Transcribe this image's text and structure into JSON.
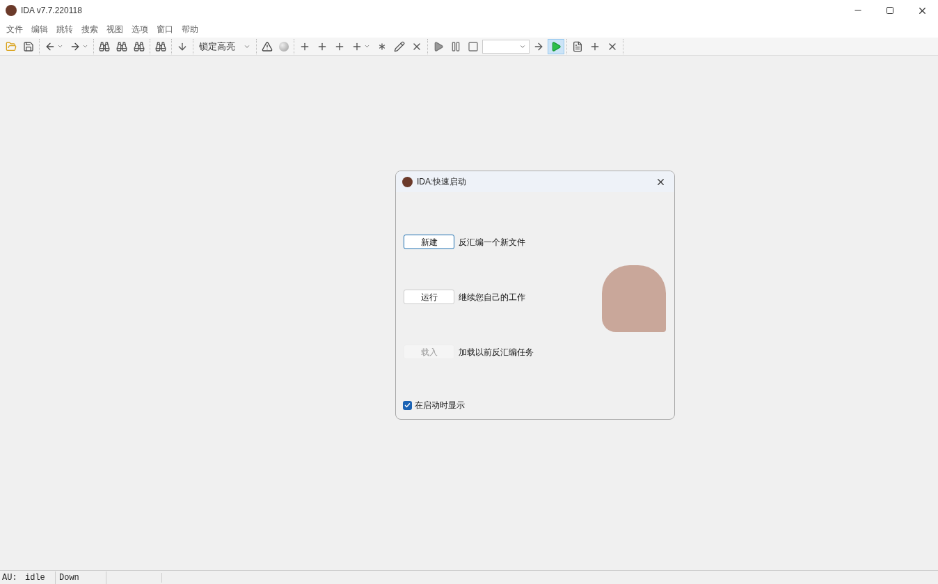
{
  "window": {
    "title": "IDA v7.7.220118"
  },
  "menu": [
    "文件",
    "编辑",
    "跳转",
    "搜索",
    "视图",
    "选项",
    "窗口",
    "帮助"
  ],
  "toolbar": [
    [
      {
        "kind": "open",
        "pressed": false
      },
      {
        "kind": "save",
        "pressed": false
      }
    ],
    [
      {
        "kind": "back",
        "pressed": false
      },
      {
        "kind": "forward",
        "pressed": false
      }
    ],
    [
      {
        "kind": "find-hex",
        "pressed": false
      },
      {
        "kind": "find-text",
        "pressed": false
      },
      {
        "kind": "find-binary",
        "pressed": false
      }
    ],
    [
      {
        "kind": "find-next",
        "pressed": false
      }
    ],
    [
      {
        "kind": "down",
        "pressed": false
      }
    ],
    [
      {
        "kind": "highlight-select",
        "label": "锁定高亮",
        "pressed": false
      }
    ],
    [
      {
        "kind": "warning",
        "pressed": false
      },
      {
        "kind": "sphere",
        "pressed": false
      }
    ],
    [
      {
        "kind": "code-plus",
        "pressed": false
      },
      {
        "kind": "data-plus",
        "pressed": false
      },
      {
        "kind": "string-plus",
        "pressed": false
      },
      {
        "kind": "struct-plus",
        "pressed": false
      },
      {
        "kind": "asterisk-plus",
        "pressed": false
      },
      {
        "kind": "edit",
        "pressed": false
      },
      {
        "kind": "undefine",
        "pressed": false
      }
    ],
    [
      {
        "kind": "play",
        "pressed": false
      },
      {
        "kind": "pause",
        "pressed": false
      },
      {
        "kind": "stop",
        "pressed": false
      },
      {
        "kind": "combo",
        "pressed": false
      },
      {
        "kind": "c-arrow",
        "pressed": false
      },
      {
        "kind": "c-play",
        "pressed": true
      }
    ],
    [
      {
        "kind": "doc",
        "pressed": false
      },
      {
        "kind": "plug-plus",
        "pressed": false
      },
      {
        "kind": "plug-x",
        "pressed": false
      }
    ]
  ],
  "dialog": {
    "title": "IDA:快速启动",
    "actions": [
      {
        "button": "新建",
        "description": "反汇编一个新文件",
        "focused": true,
        "disabled": false
      },
      {
        "button": "运行",
        "description": "继续您自己的工作",
        "focused": false,
        "disabled": false
      },
      {
        "button": "载入",
        "description": "加载以前反汇编任务",
        "focused": false,
        "disabled": true
      }
    ],
    "show_on_startup": {
      "label": "在启动时显示",
      "checked": true
    }
  },
  "status_bar": [
    "AU:",
    "idle",
    "Down"
  ]
}
